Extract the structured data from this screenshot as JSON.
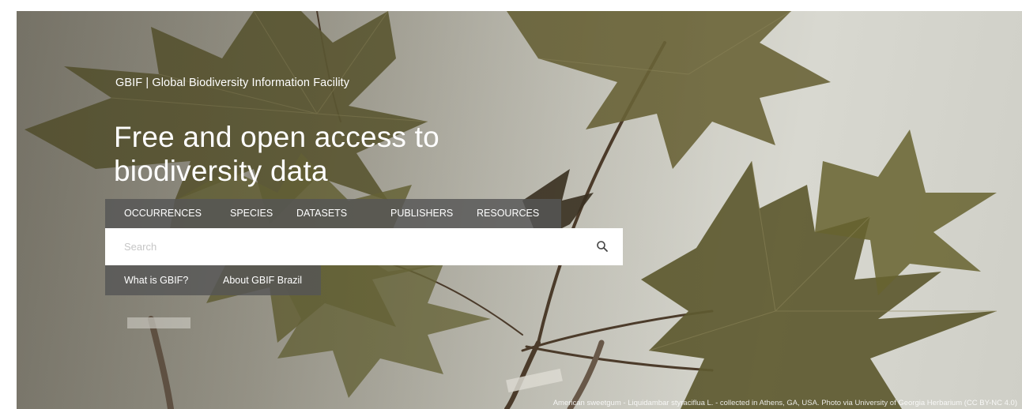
{
  "site": {
    "title": "GBIF | Global Biodiversity Information Facility"
  },
  "hero": {
    "headline": "Free and open access to biodiversity data"
  },
  "nav": {
    "tabs": [
      {
        "label": "OCCURRENCES"
      },
      {
        "label": "SPECIES"
      },
      {
        "label": "DATASETS"
      },
      {
        "label": "PUBLISHERS"
      },
      {
        "label": "RESOURCES"
      }
    ]
  },
  "search": {
    "placeholder": "Search",
    "icon": "search-icon"
  },
  "links": [
    {
      "label": "What is GBIF?"
    },
    {
      "label": "About GBIF Brazil"
    }
  ],
  "photo_credit": "American sweetgum - Liquidambar styraciflua L. - collected in Athens, GA, USA. Photo via University of Georgia Herbarium (CC BY-NC 4.0)",
  "colors": {
    "nav_background": "#555555",
    "text": "#ffffff",
    "leaf_dark": "#5e5a33",
    "leaf_light": "#75713f",
    "stem": "#4a3a2a"
  }
}
